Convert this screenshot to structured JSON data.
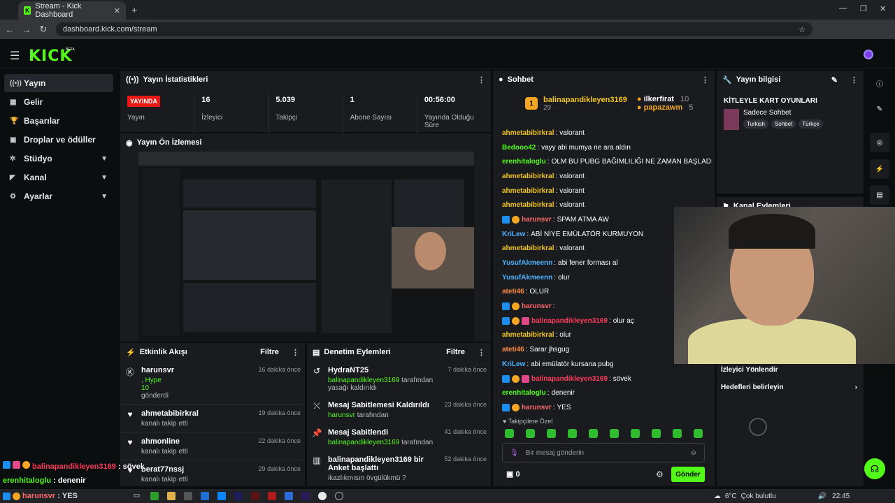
{
  "browser": {
    "tab_title": "Stream - Kick Dashboard",
    "url": "dashboard.kick.com/stream",
    "tab_favicon": "K"
  },
  "brand": {
    "logo": "KICK",
    "beta": "BETA",
    "accent": "#53fc18"
  },
  "sidebar": {
    "items": [
      {
        "label": "Yayın",
        "icon": "broadcast-icon"
      },
      {
        "label": "Gelir",
        "icon": "grid-icon"
      },
      {
        "label": "Başarılar",
        "icon": "trophy-icon"
      },
      {
        "label": "Droplar ve ödüller",
        "icon": "gift-icon"
      },
      {
        "label": "Stüdyo",
        "icon": "gear-icon"
      },
      {
        "label": "Kanal",
        "icon": "megaphone-icon"
      },
      {
        "label": "Ayarlar",
        "icon": "settings-icon"
      }
    ]
  },
  "stats": {
    "title": "Yayın İstatistikleri",
    "live": "YAYINDA",
    "items": [
      {
        "value": "",
        "label": "Yayın"
      },
      {
        "value": "16",
        "label": "İzleyici"
      },
      {
        "value": "5.039",
        "label": "Takipçi"
      },
      {
        "value": "1",
        "label": "Abone Sayısı"
      },
      {
        "value": "00:56:00",
        "label": "Yayında Olduğu Süre"
      }
    ]
  },
  "preview": {
    "title": "Yayın Ön İzlemesi"
  },
  "activity": {
    "title": "Etkinlik Akışı",
    "filter": "Filtre",
    "items": [
      {
        "name": "harunsvr",
        "sub": ", Hype",
        "extra": "10",
        "extra2": "gönderdi",
        "time": "16 dakika önce"
      },
      {
        "name": "ahmetabibirkral",
        "sub": "kanalı takip etti",
        "time": "19 dakika önce"
      },
      {
        "name": "ahmonline",
        "sub": "kanalı takip etti",
        "time": "22 dakika önce"
      },
      {
        "name": "berat77nssj",
        "sub": "kanalı takip etti",
        "time": "29 dakika önce"
      }
    ]
  },
  "moderation": {
    "title": "Denetim Eylemleri",
    "filter": "Filtre",
    "items": [
      {
        "title": "HydraNT25",
        "user": "balinapandikleyen3169",
        "action": "tarafından yasağı kaldırıldı",
        "time": "7 dakika önce"
      },
      {
        "title": "Mesaj Sabitlemesi Kaldırıldı",
        "user": "harunsvr",
        "action": "tarafından",
        "time": "23 dakika önce"
      },
      {
        "title": "Mesaj Sabitlendi",
        "user": "balinapandikleyen3169",
        "action": "tarafından",
        "time": "41 dakika önce"
      },
      {
        "title": "balinapandikleyen3169 bir Anket başlattı",
        "user": "",
        "action": "ikazlıkmısın övgülükmü ?",
        "time": "52 dakika önce"
      }
    ]
  },
  "chat": {
    "title": "Sohbet",
    "pinned": {
      "top_user": "balinapandikleyen3169",
      "top_count": "29",
      "u2": "ilkerfirat",
      "u2c": "10",
      "u3": "papazawm",
      "u3c": "5"
    },
    "messages": [
      {
        "user": "ahmetabibirkral",
        "color": "#f5c518",
        "text": "valorant",
        "badges": []
      },
      {
        "user": "Bedooo42",
        "color": "#53fc18",
        "text": "vayy abi mumya ne ara aldın",
        "badges": []
      },
      {
        "user": "erenhitaloglu",
        "color": "#53fc18",
        "text": "OLM BU PUBG BAĞIMLILIĞI NE ZAMAN BAŞLADI AMK",
        "badges": []
      },
      {
        "user": "ahmetabibirkral",
        "color": "#f5c518",
        "text": "valorant",
        "badges": []
      },
      {
        "user": "ahmetabibirkral",
        "color": "#f5c518",
        "text": "valorant",
        "badges": []
      },
      {
        "user": "ahmetabibirkral",
        "color": "#f5c518",
        "text": "valorant",
        "badges": []
      },
      {
        "user": "harunsvr",
        "color": "#ff6a6a",
        "text": "SPAM ATMA AW",
        "badges": [
          "b1",
          "b2"
        ]
      },
      {
        "user": "KriLew",
        "color": "#4fb3ff",
        "text": "ABİ NİYE EMÜLATÖR KURMUYON",
        "badges": []
      },
      {
        "user": "ahmetabibirkral",
        "color": "#f5c518",
        "text": "valorant",
        "badges": []
      },
      {
        "user": "YusufAkmeenn",
        "color": "#4fb3ff",
        "text": "abi fener forması al",
        "badges": []
      },
      {
        "user": "YusufAkmeenn",
        "color": "#4fb3ff",
        "text": "olur",
        "badges": []
      },
      {
        "user": "ateti46",
        "color": "#ff8a3d",
        "text": "OLUR",
        "badges": []
      },
      {
        "user": "harunsvr",
        "color": "#ff6a6a",
        "text": "",
        "badges": [
          "b1",
          "b2"
        ]
      },
      {
        "user": "balinapandikleyen3169",
        "color": "#ff3b5c",
        "text": "olur aç",
        "badges": [
          "b1",
          "b2",
          "b3"
        ]
      },
      {
        "user": "ahmetabibirkral",
        "color": "#f5c518",
        "text": "olur",
        "badges": []
      },
      {
        "user": "ateti46",
        "color": "#ff8a3d",
        "text": "Sarar jhsgug",
        "badges": []
      },
      {
        "user": "KriLew",
        "color": "#4fb3ff",
        "text": "abi emülatör kursana pubg",
        "badges": []
      },
      {
        "user": "balinapandikleyen3169",
        "color": "#ff3b5c",
        "text": "sövek",
        "badges": [
          "b1",
          "b2",
          "b3"
        ]
      },
      {
        "user": "erenhitaloglu",
        "color": "#53fc18",
        "text": "denenir",
        "badges": []
      },
      {
        "user": "harunsvr",
        "color": "#ff6a6a",
        "text": "YES",
        "badges": [
          "b1",
          "b2"
        ]
      }
    ],
    "followers_only": "Takipçilere Özel",
    "placeholder": "Bir mesaj gönderin",
    "send": "Gönder",
    "count": "0"
  },
  "info": {
    "title": "Yayın bilgisi",
    "stream_title": "KİTLEYLE KART OYUNLARI",
    "category": "Sadece Sohbet",
    "tags": [
      "Turkish",
      "Sohbet",
      "Türkçe"
    ],
    "actions_title": "Kanal Eylemleri",
    "raid": "İzleyici Yönlendir",
    "goals": "Hedefleri belirleyin"
  },
  "overlay": {
    "l1_user": "balinapandikleyen3169",
    "l1_text": "sövek",
    "l2_user": "erenhitaloglu",
    "l2_text": "denenir",
    "l3_user": "harunsvr",
    "l3_text": "YES"
  },
  "taskbar": {
    "weather": "6°C",
    "weather_desc": "Çok bulutlu",
    "clock": "22:45"
  }
}
